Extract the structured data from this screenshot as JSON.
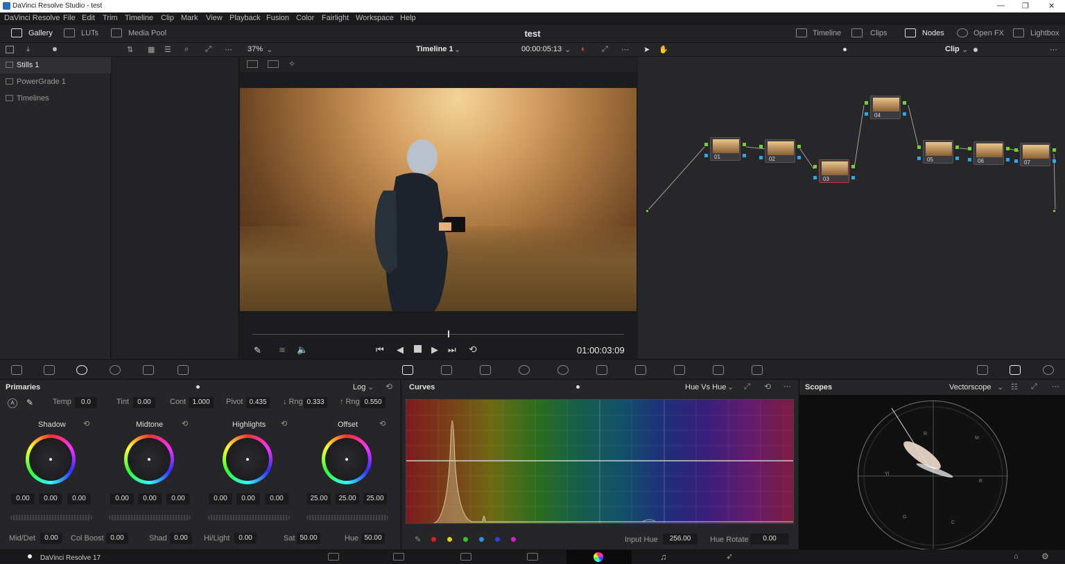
{
  "window": {
    "title": "DaVinci Resolve Studio - test",
    "minimize": "—",
    "restore": "❐",
    "close": "✕"
  },
  "menu": [
    "DaVinci Resolve",
    "File",
    "Edit",
    "Trim",
    "Timeline",
    "Clip",
    "Mark",
    "View",
    "Playback",
    "Fusion",
    "Color",
    "Fairlight",
    "Workspace",
    "Help"
  ],
  "topbar": {
    "gallery": "Gallery",
    "luts": "LUTs",
    "media_pool": "Media Pool",
    "project": "test",
    "timeline": "Timeline",
    "clips": "Clips",
    "nodes": "Nodes",
    "openfx": "Open FX",
    "lightbox": "Lightbox"
  },
  "viewer": {
    "zoom": "37%",
    "timeline_name": "Timeline 1",
    "timecode_top": "00:00:05:13",
    "timecode": "01:00:03:09"
  },
  "node_editor": {
    "mode": "Clip",
    "nodes": [
      "01",
      "02",
      "03",
      "04",
      "05",
      "06",
      "07"
    ]
  },
  "gallery": {
    "items": [
      "Stills 1",
      "PowerGrade 1",
      "Timelines"
    ]
  },
  "primaries": {
    "title": "Primaries",
    "mode": "Log",
    "temp_label": "Temp",
    "temp": "0.0",
    "tint_label": "Tint",
    "tint": "0.00",
    "cont_label": "Cont",
    "cont": "1.000",
    "pivot_label": "Pivot",
    "pivot": "0.435",
    "lrng_label": "↓ Rng",
    "lrng": "0.333",
    "hrng_label": "↑ Rng",
    "hrng": "0.550",
    "wheels": [
      {
        "name": "Shadow",
        "vals": [
          "0.00",
          "0.00",
          "0.00"
        ]
      },
      {
        "name": "Midtone",
        "vals": [
          "0.00",
          "0.00",
          "0.00"
        ]
      },
      {
        "name": "Highlights",
        "vals": [
          "0.00",
          "0.00",
          "0.00"
        ]
      },
      {
        "name": "Offset",
        "vals": [
          "25.00",
          "25.00",
          "25.00"
        ]
      }
    ],
    "middet_label": "Mid/Det",
    "middet": "0.00",
    "colboost_label": "Col Boost",
    "colboost": "0.00",
    "shad_label": "Shad",
    "shad": "0.00",
    "hilight_label": "Hi/Light",
    "hilight": "0.00",
    "sat_label": "Sat",
    "sat": "50.00",
    "hue_label": "Hue",
    "hue": "50.00"
  },
  "curves": {
    "title": "Curves",
    "mode": "Hue Vs Hue",
    "input_hue_label": "Input Hue",
    "input_hue": "256.00",
    "hue_rotate_label": "Hue Rotate",
    "hue_rotate": "0.00"
  },
  "scopes": {
    "title": "Scopes",
    "mode": "Vectorscope",
    "targets": [
      "R",
      "M",
      "B",
      "C",
      "G",
      "Yl"
    ]
  },
  "status": {
    "app": "DaVinci Resolve 17"
  },
  "colors": {
    "accent": "#e03a3a",
    "node_out": "#6fd42a",
    "node_in": "#2aa8e8"
  }
}
